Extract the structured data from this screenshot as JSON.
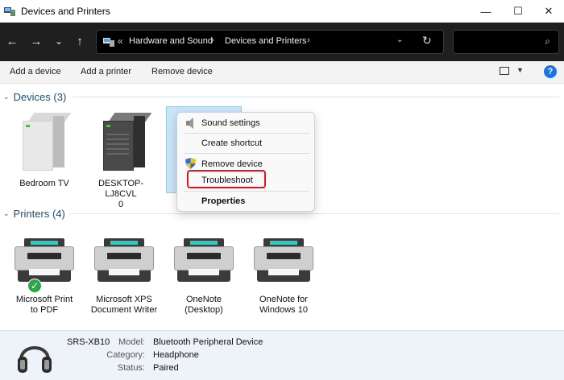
{
  "window": {
    "title": "Devices and Printers"
  },
  "titlebar": {
    "minimize": "—",
    "maximize": "☐",
    "close": "✕"
  },
  "nav": {
    "back": "←",
    "forward": "→",
    "recent": "⌄",
    "up": "↑",
    "address_prefix": "«",
    "crumbs": [
      "Hardware and Sound",
      "Devices and Printers"
    ],
    "crumb_sep": "›",
    "address_dropdown": "⌄",
    "refresh": "↻",
    "search_placeholder": "",
    "search_icon": "⌕"
  },
  "commands": {
    "add_device": "Add a device",
    "add_printer": "Add a printer",
    "remove_device": "Remove device",
    "view_dropdown": "▼",
    "help": "?"
  },
  "groups": {
    "devices": {
      "label": "Devices (3)",
      "chevron": "⌄"
    },
    "printers": {
      "label": "Printers (4)",
      "chevron": "⌄"
    }
  },
  "devices": [
    {
      "label": "Bedroom TV"
    },
    {
      "label_line1": "DESKTOP-LJ8CVL",
      "label_line2": "0"
    }
  ],
  "printers": [
    {
      "line1": "Microsoft Print",
      "line2": "to PDF",
      "default": true
    },
    {
      "line1": "Microsoft XPS",
      "line2": "Document Writer"
    },
    {
      "line1": "OneNote",
      "line2": "(Desktop)"
    },
    {
      "line1": "OneNote for",
      "line2": "Windows 10"
    }
  ],
  "context_menu": {
    "sound_settings": "Sound settings",
    "create_shortcut": "Create shortcut",
    "remove_device": "Remove device",
    "troubleshoot": "Troubleshoot",
    "properties": "Properties"
  },
  "details": {
    "name": "SRS-XB10",
    "model_key": "Model:",
    "model_val": "Bluetooth Peripheral Device",
    "category_key": "Category:",
    "category_val": "Headphone",
    "status_key": "Status:",
    "status_val": "Paired"
  },
  "check_glyph": "✓",
  "colors": {
    "group_header": "#1f4e79",
    "selection": "#cce4f7",
    "highlight": "#e0151f",
    "accent": "#1a73e8"
  }
}
